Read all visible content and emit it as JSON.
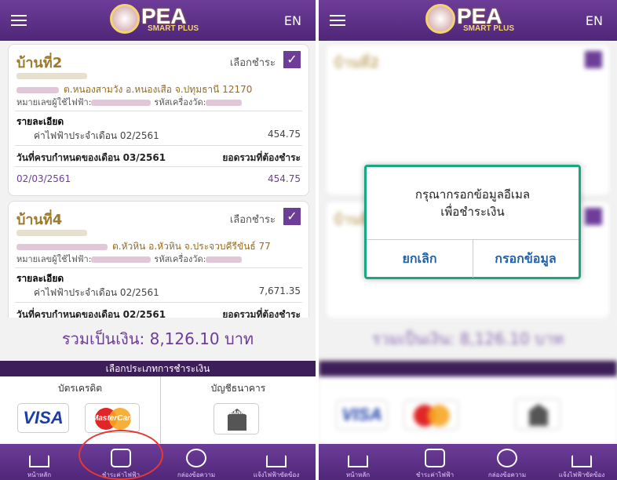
{
  "header": {
    "lang": "EN",
    "logo_text": "PEA",
    "logo_sub": "SMART PLUS"
  },
  "bills": [
    {
      "name": "บ้านที่2",
      "select": "เลือกชำระ",
      "address": "ต.หนองสามวัง อ.หนองเสือ จ.ปทุมธานี 12170",
      "meter_label": "หมายเลขผู้ใช้ไฟฟ้า:",
      "meter_code_label": "รหัสเครื่องวัด:",
      "detail": "รายละเอียด",
      "month": "ค่าไฟฟ้าประจำเดือน 02/2561",
      "amount": "454.75",
      "due": "วันที่ครบกำหนดของเดือน 03/2561",
      "total_label": "ยอดรวมที่ต้องชำระ",
      "date": "02/03/2561",
      "pay": "454.75"
    },
    {
      "name": "บ้านที่4",
      "select": "เลือกชำระ",
      "address": "ต.หัวหิน อ.หัวหิน จ.ประจวบคีรีขันธ์ 77",
      "meter_label": "หมายเลขผู้ใช้ไฟฟ้า:",
      "meter_code_label": "รหัสเครื่องวัด:",
      "detail": "รายละเอียด",
      "month": "ค่าไฟฟ้าประจำเดือน 02/2561",
      "amount": "7,671.35",
      "due": "วันที่ครบกำหนดของเดือน 02/2561",
      "total_label": "ยอดรวมที่ต้องชำระ"
    }
  ],
  "summary": "รวมเป็นเงิน: 8,126.10 บาท",
  "choose": "เลือกประเภทการชำระเงิน",
  "methods": {
    "card": "บัตรเครดิต",
    "bank": "บัญชีธนาคาร",
    "visa": "VISA",
    "mastercard": "MasterCard",
    "bank_icon": "BANK"
  },
  "nav": [
    {
      "label": "หน้าหลัก"
    },
    {
      "label": "ชำระค่าไฟฟ้า"
    },
    {
      "label": "กล่องข้อความ"
    },
    {
      "label": "แจ้งไฟฟ้าขัดข้อง"
    }
  ],
  "dialog": {
    "line1": "กรุณากรอกข้อมูลอีเมล",
    "line2": "เพื่อชำระเงิน",
    "cancel": "ยกเลิก",
    "fill": "กรอกข้อมูล"
  },
  "colors": {
    "purple": "#6d3d98",
    "dark": "#3d1e59",
    "gold": "#9e7a2c",
    "highlight": "#e53935",
    "modal": "#18a881"
  }
}
